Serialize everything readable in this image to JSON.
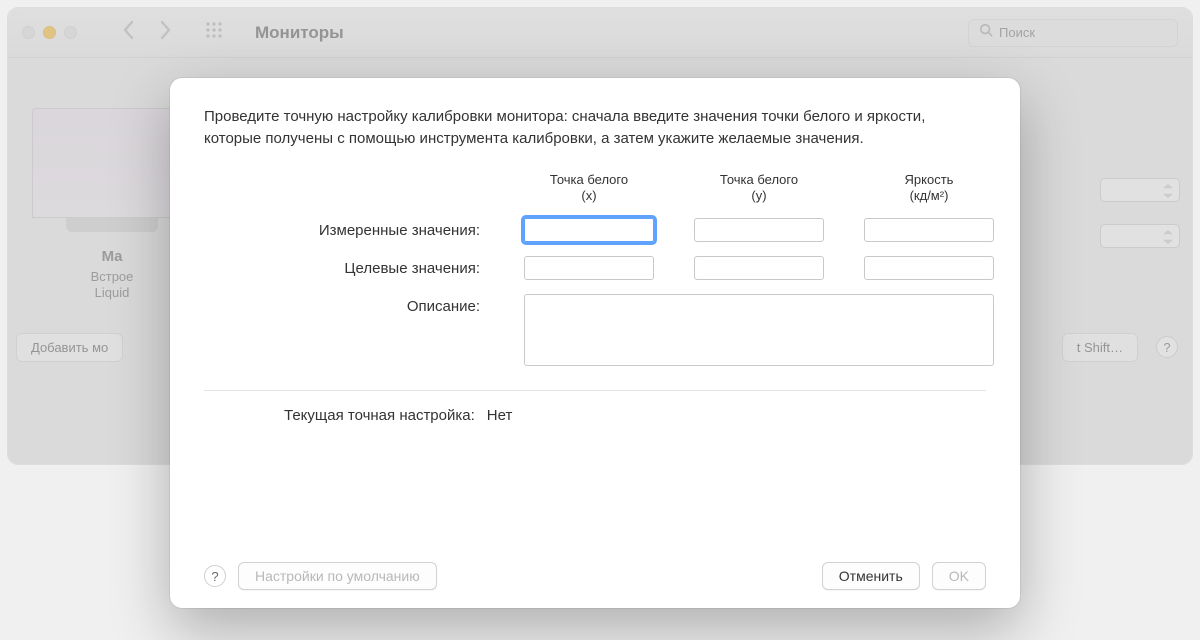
{
  "window": {
    "title": "Мониторы",
    "search_placeholder": "Поиск"
  },
  "background": {
    "monitor_name": "Ma",
    "monitor_sub1": "Встрое",
    "monitor_sub2": "Liquid",
    "add_button": "Добавить мо",
    "night_shift_button": "t Shift…",
    "help": "?"
  },
  "sheet": {
    "instruction": "Проведите точную настройку калибровки монитора: сначала введите значения точки белого и яркости, которые получены с помощью инструмента калибровки, а затем укажите желаемые значения.",
    "col1_l1": "Точка белого",
    "col1_l2": "(x)",
    "col2_l1": "Точка белого",
    "col2_l2": "(y)",
    "col3_l1": "Яркость",
    "col3_l2": "(кд/м²)",
    "row_measured": "Измеренные значения:",
    "row_target": "Целевые значения:",
    "row_desc": "Описание:",
    "measured_x": "",
    "measured_y": "",
    "measured_l": "",
    "target_x": "",
    "target_y": "",
    "target_l": "",
    "description": "",
    "current_label": "Текущая точная настройка:",
    "current_value": "Нет",
    "help": "?",
    "defaults_button": "Настройки по умолчанию",
    "cancel_button": "Отменить",
    "ok_button": "OK"
  }
}
